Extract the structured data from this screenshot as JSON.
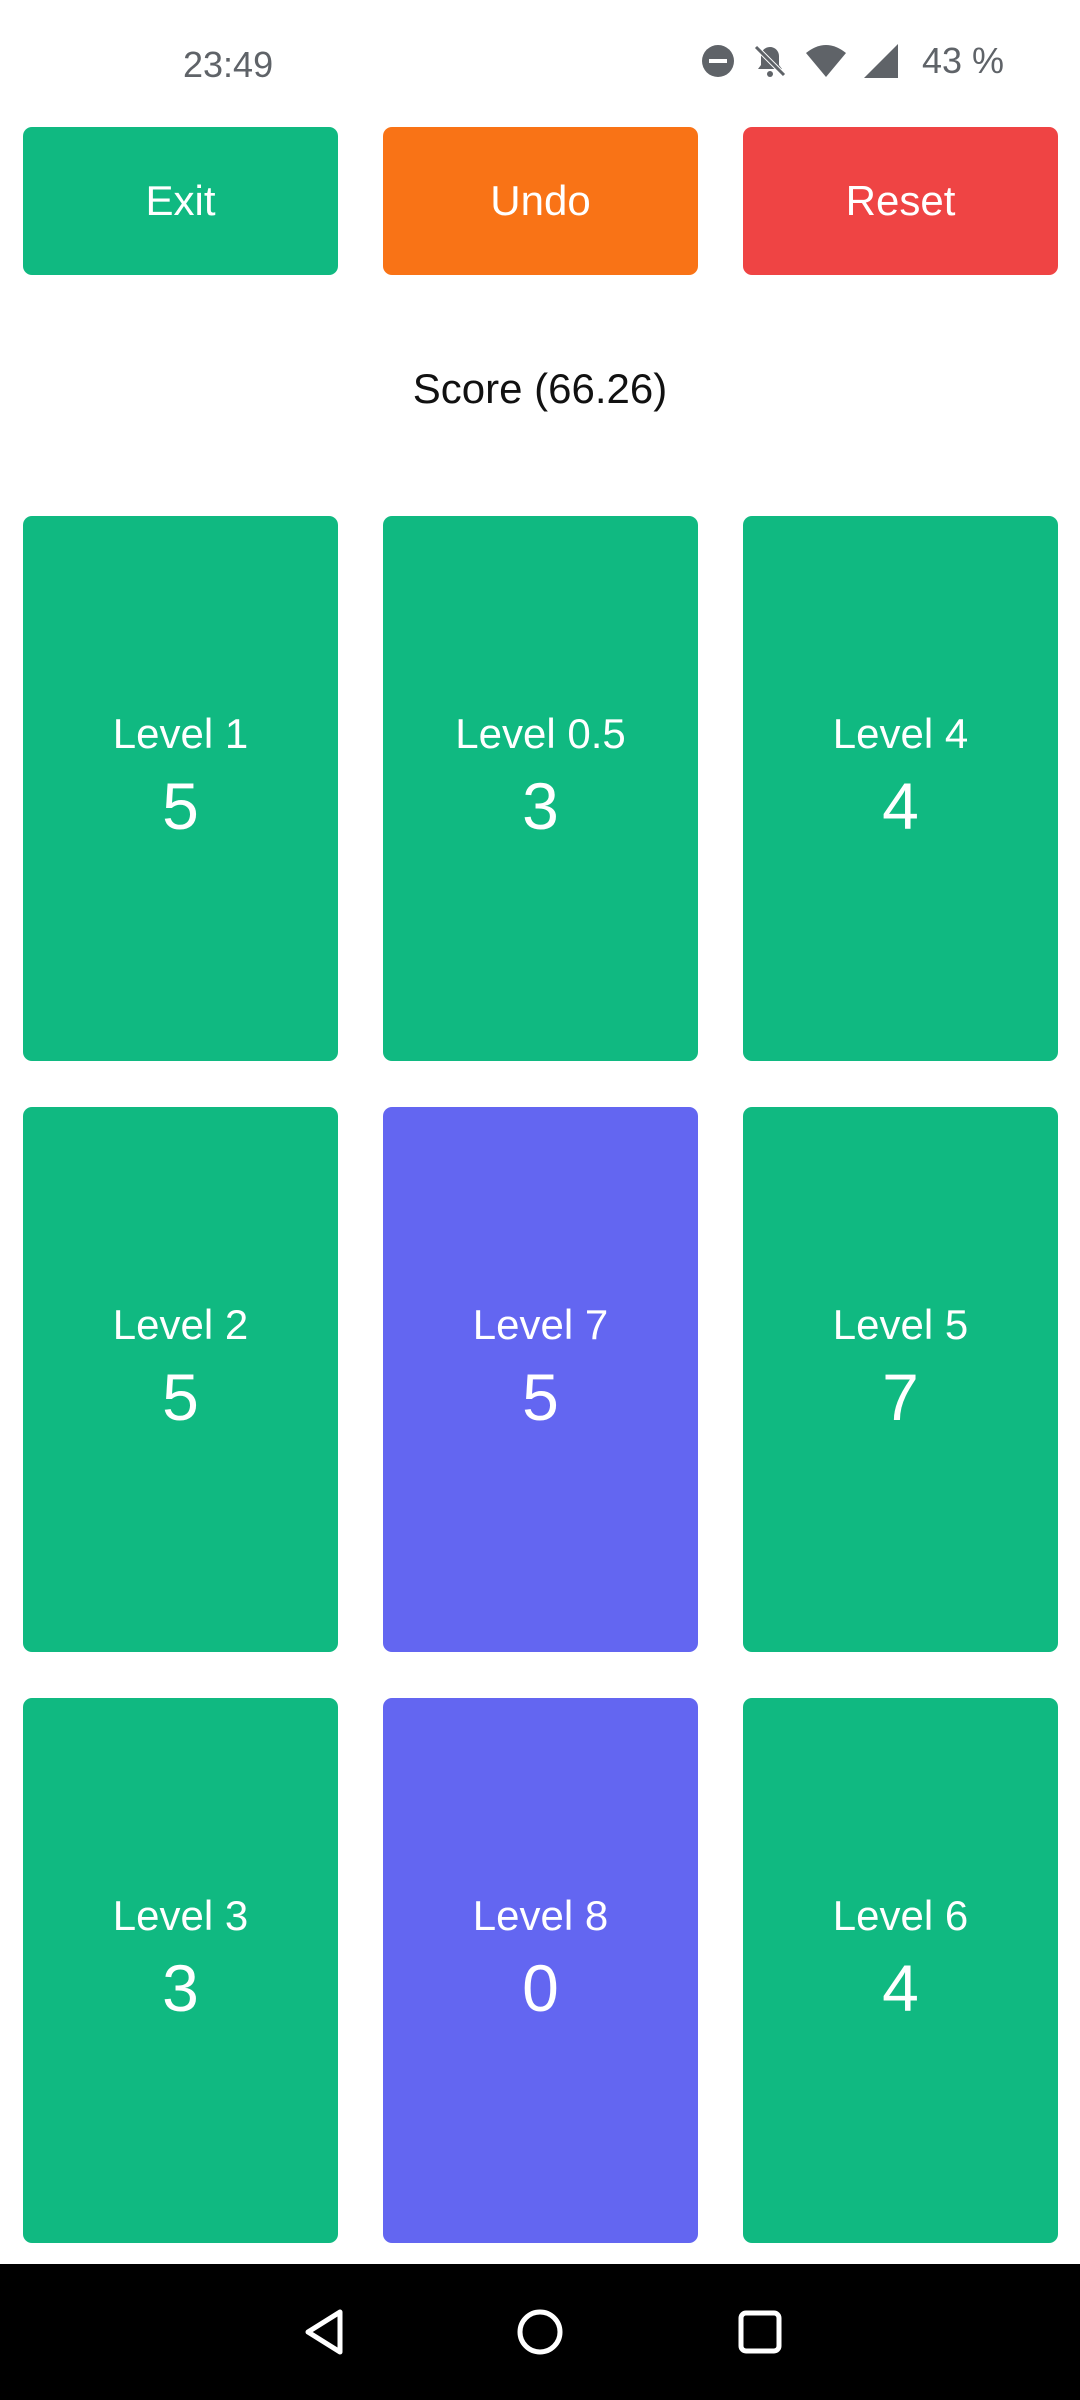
{
  "status_bar": {
    "time": "23:49",
    "battery": "43 %",
    "icons": [
      "do-not-disturb-icon",
      "notifications-off-icon",
      "wifi-icon",
      "signal-icon"
    ]
  },
  "toolbar": {
    "exit_label": "Exit",
    "undo_label": "Undo",
    "reset_label": "Reset"
  },
  "score": {
    "text": "Score (66.26)"
  },
  "levels": [
    {
      "label": "Level 1",
      "value": "5"
    },
    {
      "label": "Level 0.5",
      "value": "3"
    },
    {
      "label": "Level 4",
      "value": "4"
    },
    {
      "label": "Level 2",
      "value": "5"
    },
    {
      "label": "Level 7",
      "value": "5"
    },
    {
      "label": "Level 5",
      "value": "7"
    },
    {
      "label": "Level 3",
      "value": "3"
    },
    {
      "label": "Level 8",
      "value": "0"
    },
    {
      "label": "Level 6",
      "value": "4"
    }
  ],
  "colors": {
    "green": "#10b981",
    "orange": "#f97316",
    "red": "#ef4444",
    "purple": "#6366f1"
  },
  "nav_bar": {
    "icons": [
      "back-icon",
      "home-icon",
      "recents-icon"
    ]
  }
}
